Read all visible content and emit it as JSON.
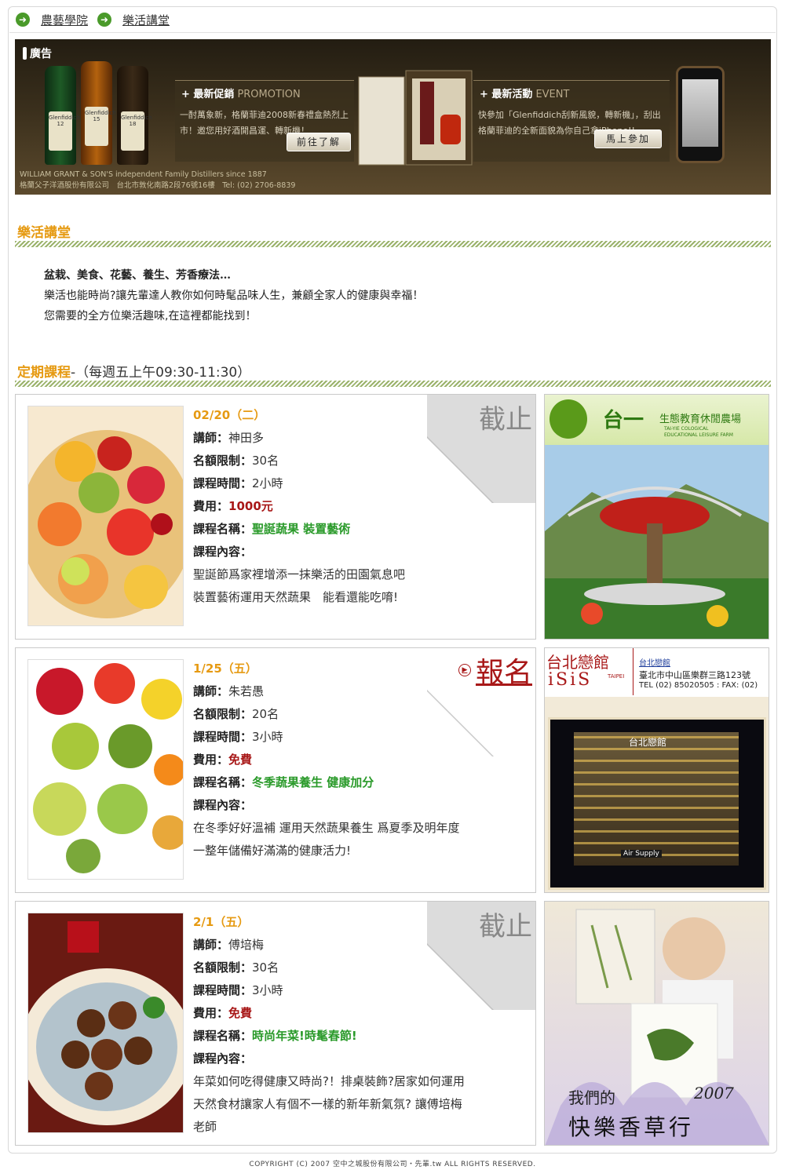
{
  "breadcrumb": {
    "items": [
      "農藝學院",
      "樂活講堂"
    ]
  },
  "ad": {
    "tag": "廣告",
    "bottles": [
      "12",
      "15",
      "18"
    ],
    "bottle_brand": "Glenfiddich",
    "promo": {
      "title": "最新促銷",
      "title_en": "PROMOTION",
      "text": "一酎萬象新，格蘭菲迪2008新春禮盒熱烈上市！邀您用好酒開昌運、轉新機！",
      "button": "前往了解"
    },
    "event": {
      "title": "最新活動",
      "title_en": "EVENT",
      "text": "快參加「Glenfiddich刮新風貌，轉新機」，刮出格蘭菲迪的全新面貌為你自己拿iPhone!!",
      "button": "馬上參加"
    },
    "footer_line1": "WILLIAM GRANT & SON'S independent Family Distillers since 1887",
    "footer_line2": "格蘭父子洋酒股份有限公司　台北市敦化南路2段76號16樓　Tel: (02) 2706-8839"
  },
  "section1": {
    "title": "樂活講堂",
    "intro_lead": "盆栽、美食、花藝、養生、芳香療法…",
    "intro_line2": "樂活也能時尚?讓先輩達人教你如何時髦品味人生，兼顧全家人的健康與幸福！",
    "intro_line3": "您需要的全方位樂活趣味,在這裡都能找到！"
  },
  "section2": {
    "title": "定期課程",
    "subtitle": "-（每週五上午09:30-11:30）"
  },
  "labels": {
    "teacher": "講師：",
    "quota": "名額限制：",
    "duration": "課程時間：",
    "fee": "費用：",
    "name": "課程名稱：",
    "content": "課程內容："
  },
  "courses": [
    {
      "date": "02/20（二）",
      "status": "截止",
      "teacher": "神田多",
      "quota": "30名",
      "duration": "2小時",
      "fee": "1000元",
      "name": "聖誕蔬果 裝置藝術",
      "content1": "聖誕節爲家裡增添一抹樂活的田園氣息吧",
      "content2": "裝置藝術運用天然蔬果　能看還能吃唷!",
      "content3": ""
    },
    {
      "date": "1/25（五）",
      "status": "報名",
      "teacher": "朱若愚",
      "quota": "20名",
      "duration": "3小時",
      "fee": "免費",
      "name": "冬季蔬果養生 健康加分",
      "content1": "在冬季好好溫補 運用天然蔬果養生 爲夏季及明年度",
      "content2": "一整年儲備好滿滿的健康活力!",
      "content3": ""
    },
    {
      "date": "2/1（五）",
      "status": "截止",
      "teacher": "傅培梅",
      "quota": "30名",
      "duration": "3小時",
      "fee": "免費",
      "name": "時尚年菜!時髦春節!",
      "content1": "年菜如何吃得健康又時尚?！排桌裝飾?居家如何運用",
      "content2": "天然食材讓家人有個不一樣的新年新氣氛? 讓傅培梅",
      "content3": "老師"
    }
  ],
  "side_ads": {
    "farm": {
      "name": "台一",
      "tagline": "生態教育休閒農場",
      "en1": "TAI-YIE COLOGICAL",
      "en2": "EDUCATIONAL LEISURE FARM"
    },
    "hotel": {
      "name": "台北戀館",
      "logo": "iSiS",
      "logo_sub": "TAIPEI",
      "link": "台北戀館",
      "address": "臺北市中山區樂群三路123號",
      "tel": "TEL (02) 85020505 : FAX: (02)",
      "sign": "台北戀館",
      "shop": "Air Supply"
    },
    "herb": {
      "year": "2007",
      "line1": "我們的",
      "line2": "快樂香草行"
    }
  },
  "footer": {
    "copyright": "COPYRIGHT (C) 2007 空中之城股份有限公司・先輩.tw ALL RIGHTS RESERVED."
  }
}
